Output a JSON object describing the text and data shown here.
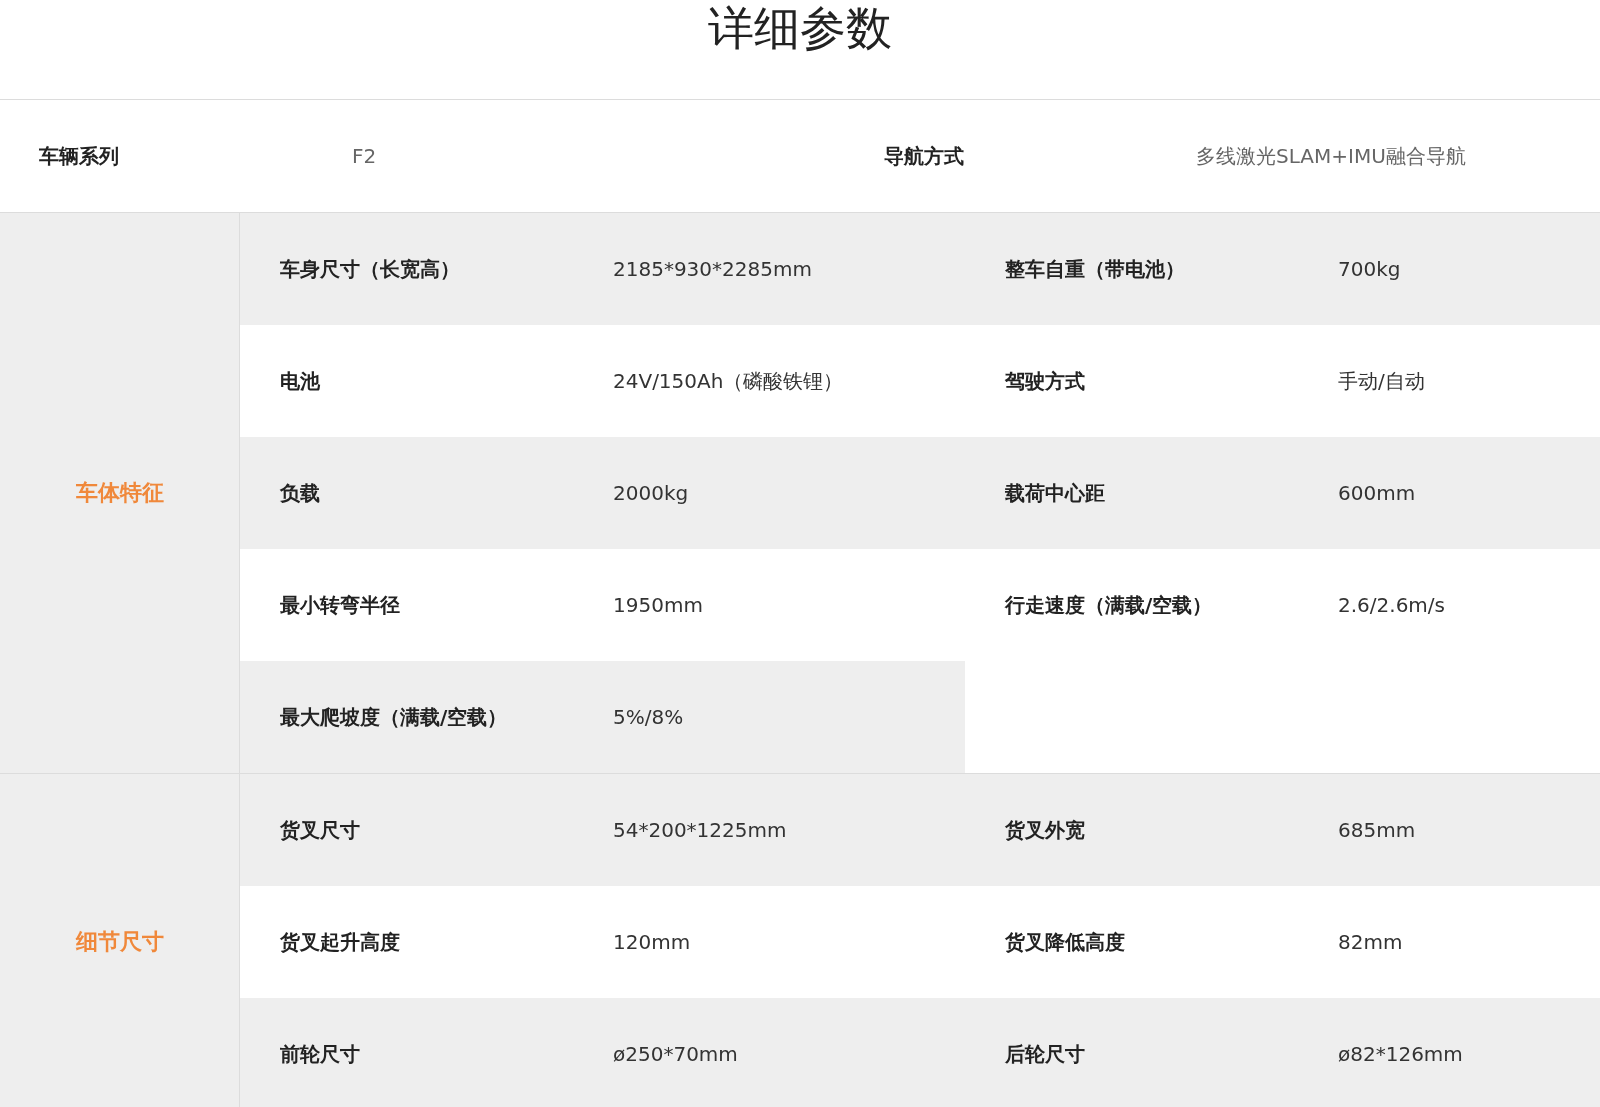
{
  "title": "详细参数",
  "summary": [
    {
      "label": "车辆系列",
      "value": "F2"
    },
    {
      "label": "导航方式",
      "value": "多线激光SLAM+IMU融合导航"
    }
  ],
  "sections": [
    {
      "name": "车体特征",
      "rows": [
        {
          "pairs": [
            {
              "label": "车身尺寸（长宽高）",
              "value": "2185*930*2285mm"
            },
            {
              "label": "整车自重（带电池）",
              "value": "700kg"
            }
          ]
        },
        {
          "pairs": [
            {
              "label": "电池",
              "value": "24V/150Ah（磷酸铁锂）"
            },
            {
              "label": "驾驶方式",
              "value": "手动/自动"
            }
          ]
        },
        {
          "pairs": [
            {
              "label": "负载",
              "value": "2000kg"
            },
            {
              "label": "载荷中心距",
              "value": "600mm"
            }
          ]
        },
        {
          "pairs": [
            {
              "label": "最小转弯半径",
              "value": "1950mm"
            },
            {
              "label": "行走速度（满载/空载）",
              "value": "2.6/2.6m/s"
            }
          ]
        },
        {
          "pairs": [
            {
              "label": "最大爬坡度（满载/空载）",
              "value": "5%/8%"
            }
          ]
        }
      ]
    },
    {
      "name": "细节尺寸",
      "rows": [
        {
          "pairs": [
            {
              "label": "货叉尺寸",
              "value": "54*200*1225mm"
            },
            {
              "label": "货叉外宽",
              "value": "685mm"
            }
          ]
        },
        {
          "pairs": [
            {
              "label": "货叉起升高度",
              "value": "120mm"
            },
            {
              "label": "货叉降低高度",
              "value": "82mm"
            }
          ]
        },
        {
          "pairs": [
            {
              "label": "前轮尺寸",
              "value": "ø250*70mm"
            },
            {
              "label": "后轮尺寸",
              "value": "ø82*126mm"
            }
          ]
        }
      ]
    }
  ]
}
